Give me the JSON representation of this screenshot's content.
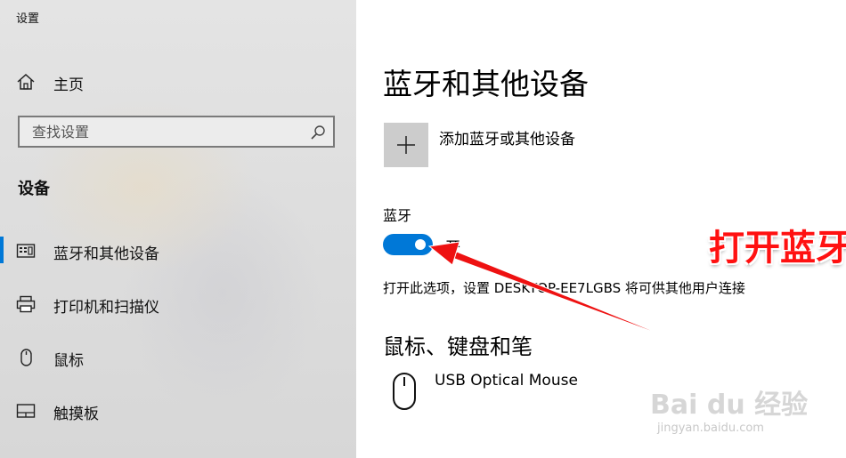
{
  "window": {
    "title": "设置"
  },
  "sidebar": {
    "home_label": "主页",
    "search": {
      "placeholder": "查找设置"
    },
    "section_title": "设备",
    "items": [
      {
        "label": "蓝牙和其他设备",
        "icon": "keyboard-device-icon",
        "selected": true
      },
      {
        "label": "打印机和扫描仪",
        "icon": "printer-icon"
      },
      {
        "label": "鼠标",
        "icon": "mouse-icon"
      },
      {
        "label": "触摸板",
        "icon": "touchpad-icon"
      }
    ]
  },
  "main": {
    "title": "蓝牙和其他设备",
    "add_device_label": "添加蓝牙或其他设备",
    "bluetooth": {
      "label": "蓝牙",
      "state_label": "开",
      "enabled": true,
      "description": "打开此选项，设置 DESKTOP-EE7LGBS 将可供其他用户连接"
    },
    "mouse_section": {
      "title": "鼠标、键盘和笔",
      "device_name": "USB Optical Mouse"
    }
  },
  "annotation": {
    "text": "打开蓝牙",
    "color": "#ff1111"
  },
  "watermark": {
    "text": "Bai du 经验",
    "url": "jingyan.baidu.com"
  },
  "colors": {
    "accent": "#0078d7"
  }
}
